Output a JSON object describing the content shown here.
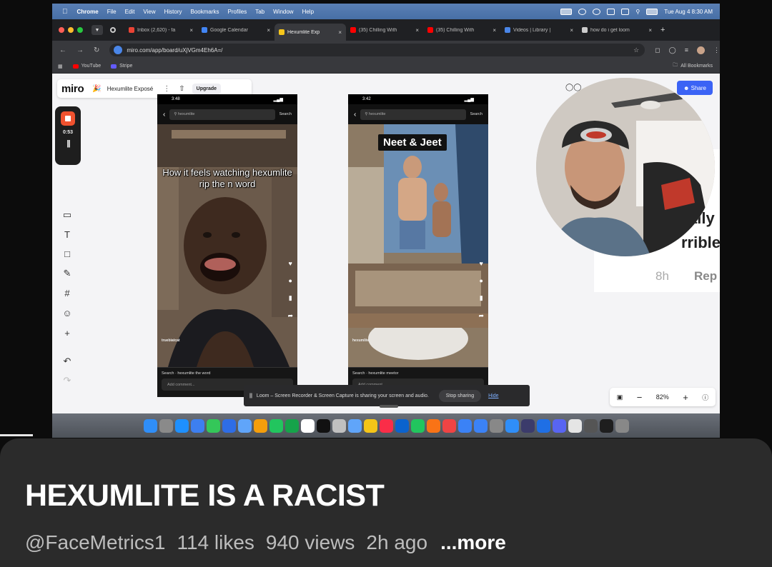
{
  "menubar": {
    "app": "Chrome",
    "menus": [
      "File",
      "Edit",
      "View",
      "History",
      "Bookmarks",
      "Profiles",
      "Tab",
      "Window",
      "Help"
    ],
    "clock": "Tue Aug 4  8:30 AM"
  },
  "tabs": [
    {
      "title": "Inbox (2,620) - fa",
      "color": "#ea4335"
    },
    {
      "title": "Google Calendar",
      "color": "#4285f4"
    },
    {
      "title": "Hexumlite Exp",
      "color": "#f6c61b"
    },
    {
      "title": "(35) Chilling With",
      "color": "#ff0000"
    },
    {
      "title": "(35) Chilling With",
      "color": "#ff0000"
    },
    {
      "title": "Videos | Library |",
      "color": "#4a86e8"
    },
    {
      "title": "how do i get loom",
      "color": "#cccccc"
    }
  ],
  "urlbar": {
    "url": "miro.com/app/board/uXjVGm4Eh6A=/"
  },
  "bookmarks": {
    "items": [
      {
        "label": "YouTube",
        "color": "#ff0000"
      },
      {
        "label": "Stripe",
        "color": "#635bff"
      }
    ],
    "all": "All Bookmarks"
  },
  "miro": {
    "logo": "miro",
    "board_name": "Hexumlite Exposé",
    "upgrade": "Upgrade",
    "share": "Share",
    "zoom": "82%"
  },
  "loom": {
    "timer": "0:53",
    "banner": "Loom – Screen Recorder & Screen Capture is sharing your screen and audio.",
    "stop": "Stop sharing",
    "hide": "Hide"
  },
  "phone1": {
    "time": "3:48",
    "search": "hexumlite",
    "search_btn": "Search",
    "overlay": "How it feels watching hexumlite rip the n word",
    "username": "truebiatcat",
    "search_line": "Search · hexumlite the word",
    "comment": "Add comment..."
  },
  "phone2": {
    "time": "3:42",
    "search": "hexumlite",
    "search_btn": "Search",
    "label": "Neet & Jeet",
    "username": "hexumlite",
    "search_line": "Search · hexumlite meetor",
    "comment": "Add comment..."
  },
  "background_text": {
    "line1": "ally",
    "line2": "rrible",
    "time": "8h",
    "reply": "Rep"
  },
  "dock_colors": [
    "#2f8ef8",
    "#8a8a8a",
    "#1e90ff",
    "#3d7ff0",
    "#34c759",
    "#2e6de6",
    "#60a5fa",
    "#f59e0b",
    "#22c55e",
    "#16a34a",
    "#ffffff",
    "#111111",
    "#c0c0c0",
    "#60a5fa",
    "#f5c518",
    "#fa2d48",
    "#0b63ce",
    "#22c55e",
    "#f97316",
    "#ef4444",
    "#3b82f6",
    "#3b82f6",
    "#888888",
    "#2f8ef8",
    "#3b3b6b",
    "#1f6fe5",
    "#5865f2",
    "#e5e5e5",
    "#555555",
    "#1e1e1e",
    "#888888"
  ],
  "video": {
    "title": "HEXUMLITE IS A RACIST",
    "channel": "@FaceMetrics1",
    "likes": "114 likes",
    "views": "940 views",
    "age": "2h ago",
    "more": "...more"
  }
}
